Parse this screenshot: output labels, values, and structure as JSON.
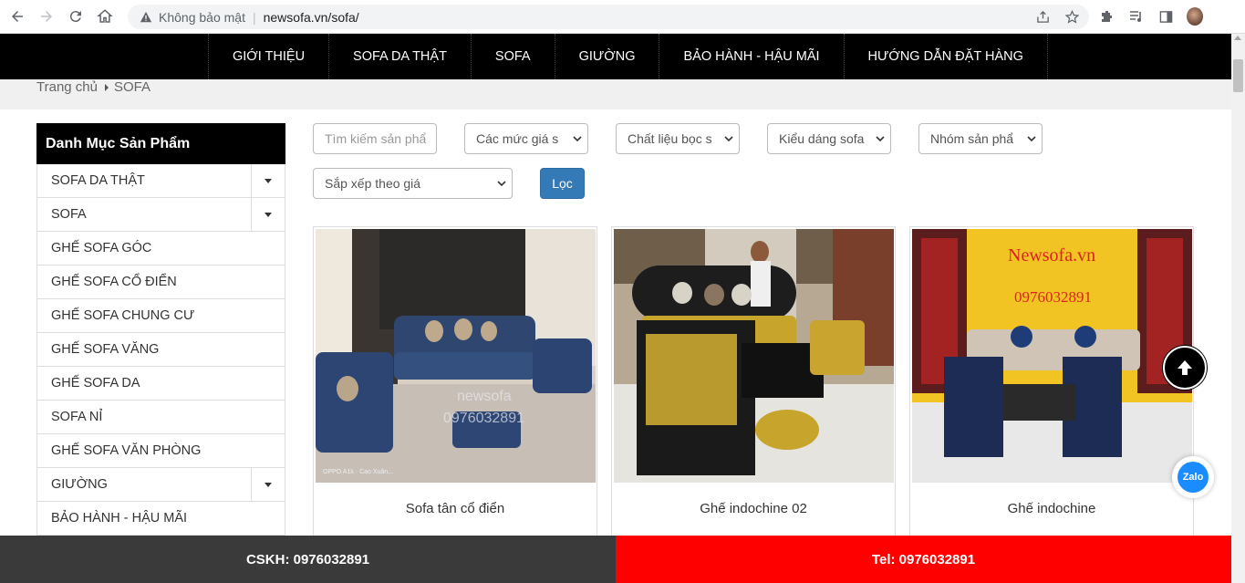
{
  "browser": {
    "security_label": "Không bảo mật",
    "url": "newsofa.vn/sofa/"
  },
  "menu": {
    "items": [
      "GIỚI THIỆU",
      "SOFA DA THẬT",
      "SOFA",
      "GIƯỜNG",
      "BẢO HÀNH - HẬU MÃI",
      "HƯỚNG DẪN ĐẶT HÀNG"
    ]
  },
  "breadcrumb": {
    "home": "Trang chủ",
    "current": "SOFA"
  },
  "sidebar": {
    "title": "Danh Mục Sản Phẩm",
    "items": [
      {
        "label": "SOFA DA THẬT",
        "has_toggle": true
      },
      {
        "label": "SOFA",
        "has_toggle": true
      },
      {
        "label": "GHẾ SOFA GÓC",
        "has_toggle": false
      },
      {
        "label": "GHẾ SOFA CỔ ĐIỂN",
        "has_toggle": false
      },
      {
        "label": "GHẾ SOFA CHUNG CƯ",
        "has_toggle": false
      },
      {
        "label": "GHẾ SOFA VĂNG",
        "has_toggle": false
      },
      {
        "label": "GHẾ SOFA DA",
        "has_toggle": false
      },
      {
        "label": "SOFA NỈ",
        "has_toggle": false
      },
      {
        "label": "GHẾ SOFA VĂN PHÒNG",
        "has_toggle": false
      },
      {
        "label": "GIƯỜNG",
        "has_toggle": true
      },
      {
        "label": "BẢO HÀNH - HẬU MÃI",
        "has_toggle": false
      }
    ]
  },
  "filters": {
    "search_placeholder": "Tìm kiếm sản phẩ",
    "price": "Các mức giá s",
    "material": "Chất liệu bọc s",
    "style": "Kiểu dáng sofa",
    "group": "Nhóm sản phẩ",
    "sort": "Sắp xếp theo giá",
    "submit": "Lọc"
  },
  "products": [
    {
      "name": "Sofa tân cổ điển",
      "watermark": "newsofa",
      "watermark_phone": "0976032891",
      "camera_tag": "OPPO A1k · Cao Xuân..."
    },
    {
      "name": "Ghế indochine 02"
    },
    {
      "name": "Ghế indochine",
      "banner_text": "Newsofa.vn",
      "banner_phone": "0976032891"
    }
  ],
  "bottom_bar": {
    "left": "CSKH: 0976032891",
    "right": "Tel: 0976032891"
  },
  "floating": {
    "zalo": "Zalo"
  },
  "colors": {
    "menu_bg": "#000000",
    "filter_button": "#337ab7",
    "bottom_left": "#3a3a3a",
    "bottom_right": "#ff0000"
  }
}
